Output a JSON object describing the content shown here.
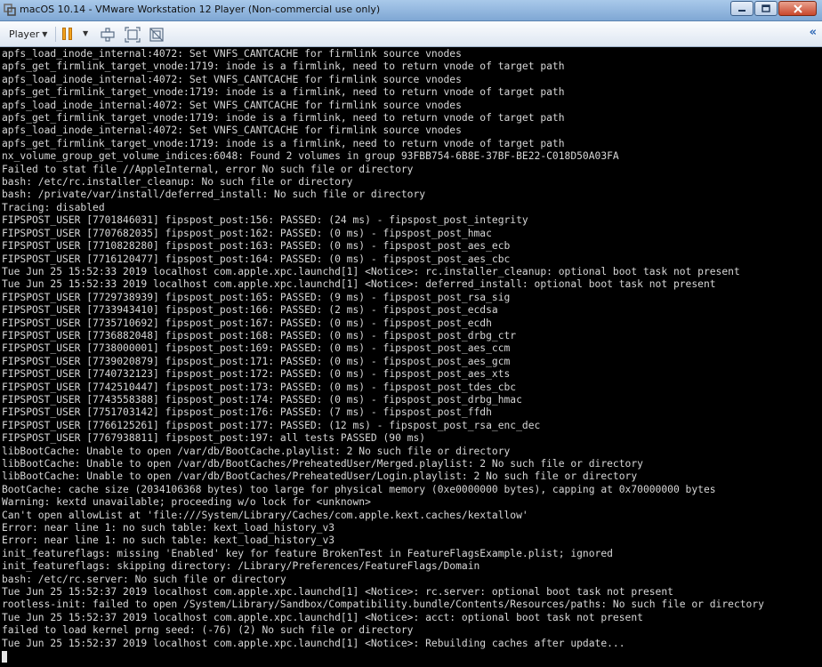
{
  "window": {
    "title": "macOS 10.14 - VMware Workstation 12 Player (Non-commercial use only)"
  },
  "toolbar": {
    "player_label": "Player",
    "icons": [
      "pause-icon",
      "send-ctrl-alt-del-icon",
      "fullscreen-icon",
      "unity-icon",
      "collapse-icon"
    ],
    "collapse_label": "«"
  },
  "console": {
    "lines": [
      "apfs_load_inode_internal:4072: Set VNFS_CANTCACHE for firmlink source vnodes",
      "apfs_get_firmlink_target_vnode:1719: inode is a firmlink, need to return vnode of target path",
      "apfs_load_inode_internal:4072: Set VNFS_CANTCACHE for firmlink source vnodes",
      "apfs_get_firmlink_target_vnode:1719: inode is a firmlink, need to return vnode of target path",
      "apfs_load_inode_internal:4072: Set VNFS_CANTCACHE for firmlink source vnodes",
      "apfs_get_firmlink_target_vnode:1719: inode is a firmlink, need to return vnode of target path",
      "apfs_load_inode_internal:4072: Set VNFS_CANTCACHE for firmlink source vnodes",
      "apfs_get_firmlink_target_vnode:1719: inode is a firmlink, need to return vnode of target path",
      "nx_volume_group_get_volume_indices:6048: Found 2 volumes in group 93FBB754-6B8E-37BF-BE22-C018D50A03FA",
      "Failed to stat file //AppleInternal, error No such file or directory",
      "bash: /etc/rc.installer_cleanup: No such file or directory",
      "bash: /private/var/install/deferred_install: No such file or directory",
      "Tracing: disabled",
      "FIPSPOST_USER [7701846031] fipspost_post:156: PASSED: (24 ms) - fipspost_post_integrity",
      "FIPSPOST_USER [7707682035] fipspost_post:162: PASSED: (0 ms) - fipspost_post_hmac",
      "FIPSPOST_USER [7710828280] fipspost_post:163: PASSED: (0 ms) - fipspost_post_aes_ecb",
      "FIPSPOST_USER [7716120477] fipspost_post:164: PASSED: (0 ms) - fipspost_post_aes_cbc",
      "Tue Jun 25 15:52:33 2019 localhost com.apple.xpc.launchd[1] <Notice>: rc.installer_cleanup: optional boot task not present",
      "Tue Jun 25 15:52:33 2019 localhost com.apple.xpc.launchd[1] <Notice>: deferred_install: optional boot task not present",
      "FIPSPOST_USER [7729738939] fipspost_post:165: PASSED: (9 ms) - fipspost_post_rsa_sig",
      "FIPSPOST_USER [7733943410] fipspost_post:166: PASSED: (2 ms) - fipspost_post_ecdsa",
      "FIPSPOST_USER [7735710692] fipspost_post:167: PASSED: (0 ms) - fipspost_post_ecdh",
      "FIPSPOST_USER [7736882048] fipspost_post:168: PASSED: (0 ms) - fipspost_post_drbg_ctr",
      "FIPSPOST_USER [7738000001] fipspost_post:169: PASSED: (0 ms) - fipspost_post_aes_ccm",
      "FIPSPOST_USER [7739020879] fipspost_post:171: PASSED: (0 ms) - fipspost_post_aes_gcm",
      "FIPSPOST_USER [7740732123] fipspost_post:172: PASSED: (0 ms) - fipspost_post_aes_xts",
      "FIPSPOST_USER [7742510447] fipspost_post:173: PASSED: (0 ms) - fipspost_post_tdes_cbc",
      "FIPSPOST_USER [7743558388] fipspost_post:174: PASSED: (0 ms) - fipspost_post_drbg_hmac",
      "FIPSPOST_USER [7751703142] fipspost_post:176: PASSED: (7 ms) - fipspost_post_ffdh",
      "FIPSPOST_USER [7766125261] fipspost_post:177: PASSED: (12 ms) - fipspost_post_rsa_enc_dec",
      "FIPSPOST_USER [7767938811] fipspost_post:197: all tests PASSED (90 ms)",
      "libBootCache: Unable to open /var/db/BootCache.playlist: 2 No such file or directory",
      "libBootCache: Unable to open /var/db/BootCaches/PreheatedUser/Merged.playlist: 2 No such file or directory",
      "libBootCache: Unable to open /var/db/BootCaches/PreheatedUser/Login.playlist: 2 No such file or directory",
      "BootCache: cache size (2034106368 bytes) too large for physical memory (0xe0000000 bytes), capping at 0x70000000 bytes",
      "Warning: kextd unavailable; proceeding w/o lock for <unknown>",
      "Can't open allowList at 'file:///System/Library/Caches/com.apple.kext.caches/kextallow'",
      "Error: near line 1: no such table: kext_load_history_v3",
      "Error: near line 1: no such table: kext_load_history_v3",
      "init_featureflags: missing 'Enabled' key for feature BrokenTest in FeatureFlagsExample.plist; ignored",
      "init_featureflags: skipping directory: /Library/Preferences/FeatureFlags/Domain",
      "bash: /etc/rc.server: No such file or directory",
      "Tue Jun 25 15:52:37 2019 localhost com.apple.xpc.launchd[1] <Notice>: rc.server: optional boot task not present",
      "rootless-init: failed to open /System/Library/Sandbox/Compatibility.bundle/Contents/Resources/paths: No such file or directory",
      "Tue Jun 25 15:52:37 2019 localhost com.apple.xpc.launchd[1] <Notice>: acct: optional boot task not present",
      "failed to load kernel prng seed: (-76) (2) No such file or directory",
      "Tue Jun 25 15:52:37 2019 localhost com.apple.xpc.launchd[1] <Notice>: Rebuilding caches after update..."
    ]
  },
  "colors": {
    "console_bg": "#000000",
    "console_text": "#d8d8d8",
    "pause_accent": "#f2a21d"
  }
}
